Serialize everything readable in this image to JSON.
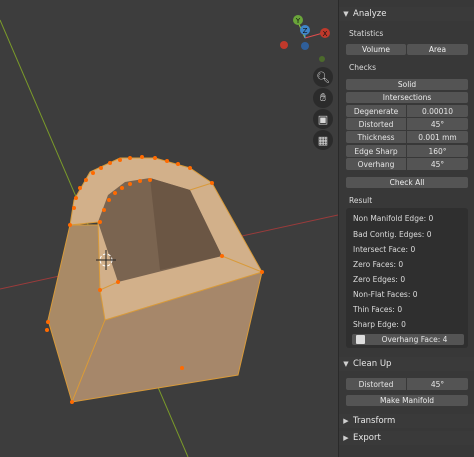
{
  "colors": {
    "accent": "#ff6a00",
    "mesh_face": "#c8a176",
    "sidebar_bg": "#383838",
    "button_bg": "#545454"
  },
  "viewport": {
    "gizmo": {
      "y_label": "Y",
      "z_label": "Z",
      "x_label": "X"
    },
    "tools": [
      "zoom-icon",
      "hand-icon",
      "camera-icon",
      "grid-icon"
    ]
  },
  "analyze": {
    "title": "Analyze",
    "statistics_label": "Statistics",
    "volume_label": "Volume",
    "area_label": "Area",
    "checks_label": "Checks",
    "solid_label": "Solid",
    "intersections_label": "Intersections",
    "checks": [
      {
        "label": "Degenerate",
        "value": "0.00010"
      },
      {
        "label": "Distorted",
        "value": "45°"
      },
      {
        "label": "Thickness",
        "value": "0.001 mm"
      },
      {
        "label": "Edge Sharp",
        "value": "160°"
      },
      {
        "label": "Overhang",
        "value": "45°"
      }
    ],
    "check_all_label": "Check All",
    "result_label": "Result",
    "results": [
      "Non Manifold Edge: 0",
      "Bad Contig. Edges: 0",
      "Intersect Face: 0",
      "Zero Faces: 0",
      "Zero Edges: 0",
      "Non-Flat Faces: 0",
      "Thin Faces: 0",
      "Sharp Edge: 0"
    ],
    "overhang_result": "Overhang Face: 4"
  },
  "cleanup": {
    "title": "Clean Up",
    "distorted_label": "Distorted",
    "distorted_value": "45°",
    "make_manifold_label": "Make Manifold"
  },
  "transform": {
    "title": "Transform"
  },
  "export": {
    "title": "Export"
  }
}
